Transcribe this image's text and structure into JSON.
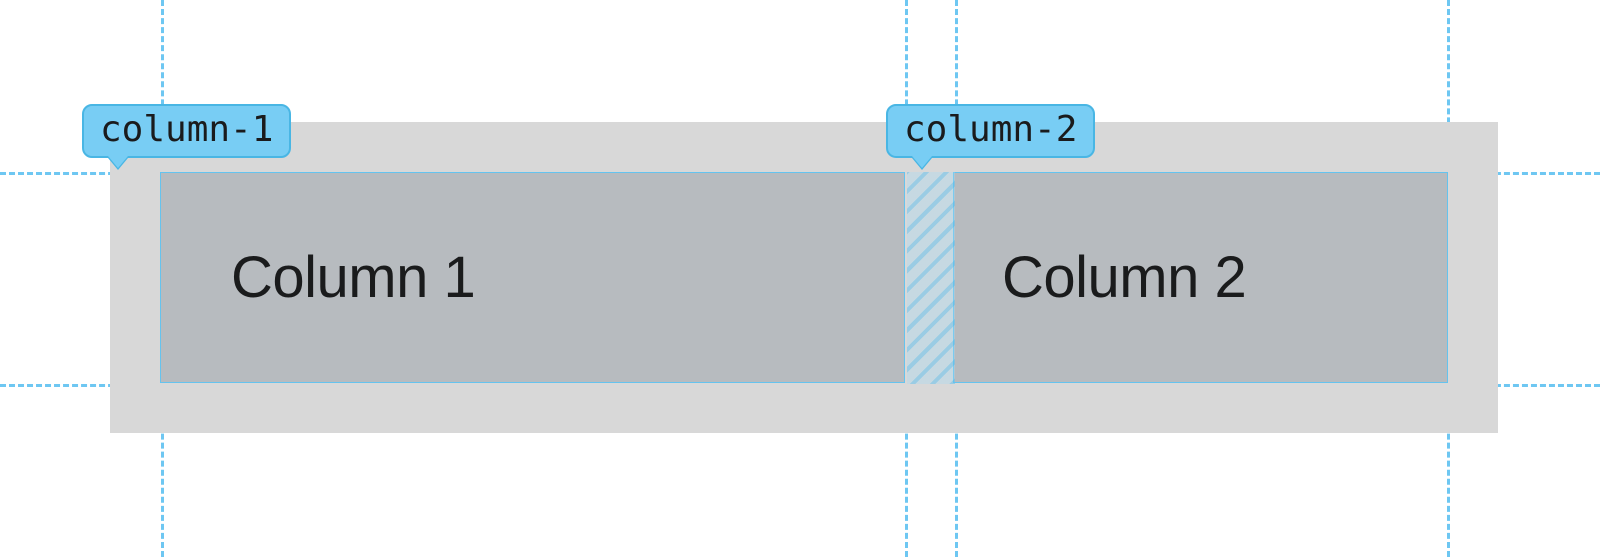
{
  "grid": {
    "columns": [
      {
        "track_name": "column-1",
        "cell_label": "Column 1"
      },
      {
        "track_name": "column-2",
        "cell_label": "Column 2"
      }
    ]
  }
}
